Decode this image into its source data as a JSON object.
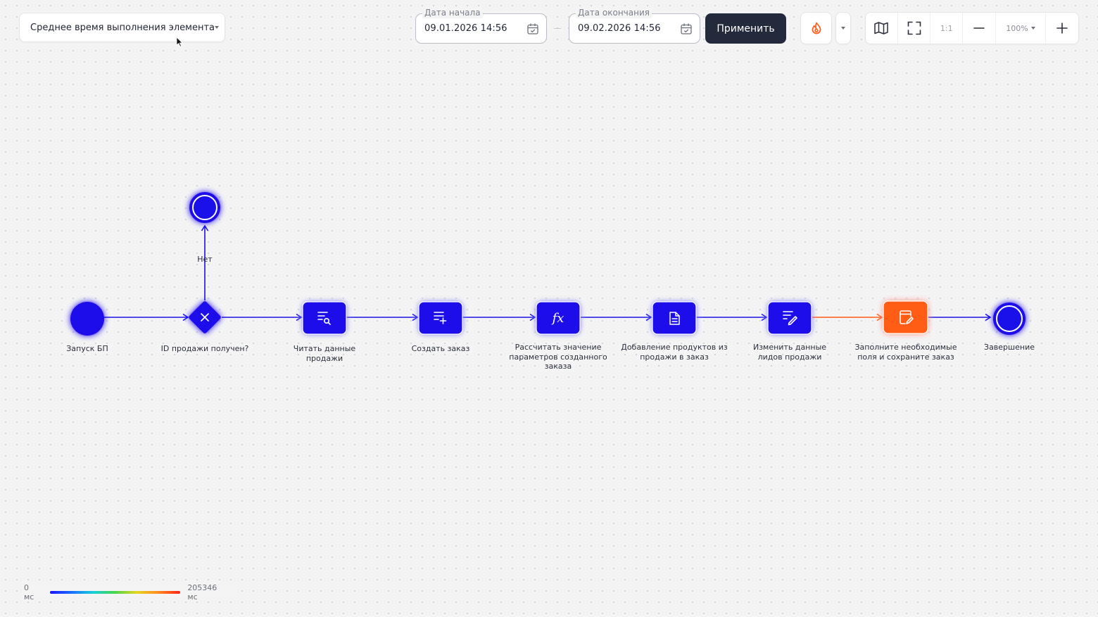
{
  "toolbar": {
    "metric": {
      "selected": "Среднее время выполнения элемента"
    },
    "start_date": {
      "legend": "Дата начала",
      "value": "09.01.2026 14:56"
    },
    "end_date": {
      "legend": "Дата окончания",
      "value": "09.02.2026 14:56"
    },
    "apply_label": "Применить",
    "ratio_label": "1:1",
    "zoom_label": "100%"
  },
  "diagram": {
    "nodes": [
      {
        "id": "start",
        "label": "Запуск БП",
        "type": "start-event"
      },
      {
        "id": "gateway",
        "label": "ID продажи получен?",
        "type": "exclusive-gateway"
      },
      {
        "id": "end-no",
        "label": "",
        "type": "end-event"
      },
      {
        "id": "read",
        "label": "Читать данные продажи",
        "type": "task",
        "icon": "read-data-icon"
      },
      {
        "id": "create",
        "label": "Создать заказ",
        "type": "task",
        "icon": "create-record-icon"
      },
      {
        "id": "calc",
        "label": "Рассчитать значение параметров созданного заказа",
        "type": "task",
        "icon": "formula-icon"
      },
      {
        "id": "add",
        "label": "Добавление продуктов из продажи в заказ",
        "type": "task",
        "icon": "document-icon"
      },
      {
        "id": "modify",
        "label": "Изменить данные лидов продажи",
        "type": "task",
        "icon": "edit-data-icon"
      },
      {
        "id": "fill",
        "label": "Заполните необходимые поля и сохраните заказ",
        "type": "user-task",
        "icon": "page-edit-icon"
      },
      {
        "id": "end",
        "label": "Завершение",
        "type": "end-event"
      }
    ],
    "flows": [
      {
        "from": "gateway",
        "to": "end-no",
        "label": "Нет"
      }
    ],
    "colors": {
      "cold": "#1a10ea",
      "hot": "#ff5b14",
      "accent": "#232a3b"
    }
  },
  "legend": {
    "min_label": "0 мс",
    "max_label": "205346 мс"
  }
}
